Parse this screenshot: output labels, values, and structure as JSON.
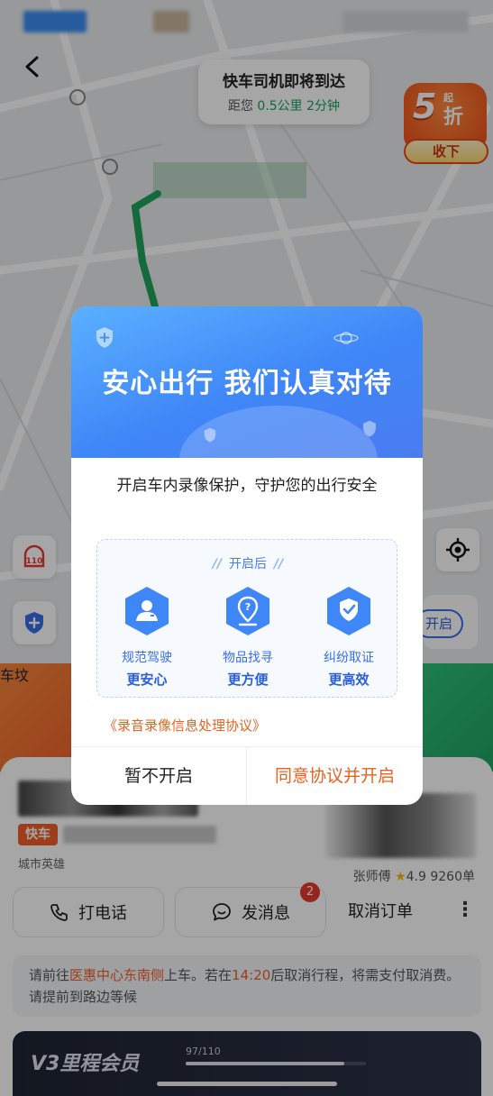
{
  "map": {
    "eta_title": "快车司机即将到达",
    "eta_prefix": "距您",
    "eta_distance": "0.5公里",
    "eta_time": "2分钟",
    "promo_number": "5",
    "promo_sup": "起",
    "promo_unit": "折",
    "promo_button": "收下",
    "tool_110_label": "110",
    "open_pill_label": "开启",
    "colors": {
      "route": "#1fa35a",
      "accent_orange": "#f05f2b",
      "accent_blue": "#3a6ee8"
    }
  },
  "banner": {
    "right_text": "车坟"
  },
  "trip": {
    "service_tag": "快车",
    "driver_title": "城市英雄",
    "driver_name": "张师傅",
    "rating": "4.9",
    "orders": "9260单",
    "call_label": "打电话",
    "message_label": "发消息",
    "message_badge": "2",
    "cancel_label": "取消订单",
    "more_label": "⋮",
    "notice_prefix": "请前往",
    "notice_location": "医惠中心东南侧",
    "notice_mid": "上车。若在",
    "notice_time": "14:20",
    "notice_suffix": "后取消行程，将需支付取消费。请提前到路边等候"
  },
  "member": {
    "title": "V3里程会员",
    "progress_text": "97/110",
    "progress_fraction": 0.882
  },
  "dialog": {
    "title": "安心出行 我们认真对待",
    "description": "开启车内录像保护，守护您的出行安全",
    "feature_header": "开启后",
    "features": [
      {
        "label": "规范驾驶",
        "sub": "更安心",
        "icon": "driver-icon"
      },
      {
        "label": "物品找寻",
        "sub": "更方便",
        "icon": "item-search-icon"
      },
      {
        "label": "纠纷取证",
        "sub": "更高效",
        "icon": "shield-check-icon"
      }
    ],
    "agreement_link": "《录音录像信息处理协议》",
    "decline_label": "暂不开启",
    "accept_label": "同意协议并开启"
  }
}
